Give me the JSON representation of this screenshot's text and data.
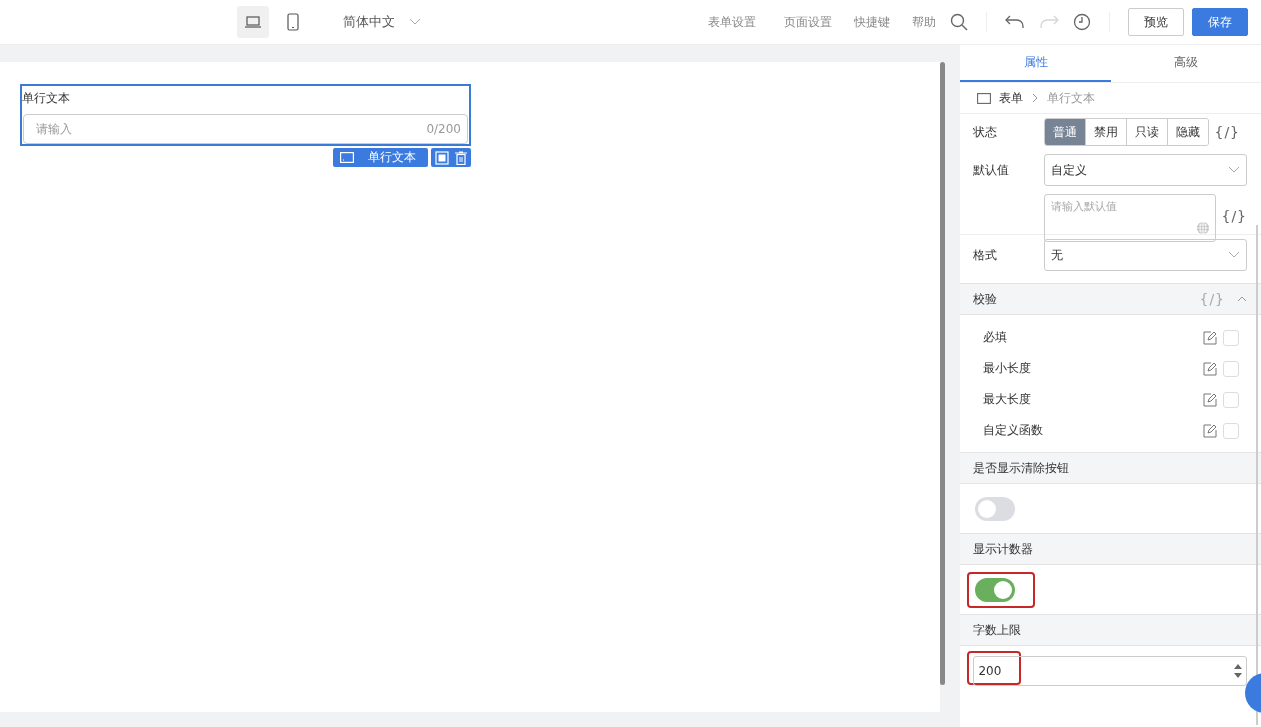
{
  "toolbar": {
    "devices": [
      {
        "kind": "desktop",
        "selected": true
      },
      {
        "kind": "mobile",
        "selected": false
      }
    ],
    "language": "简体中文",
    "links": [
      "表单设置",
      "页面设置",
      "快捷键",
      "帮助"
    ],
    "history": [
      {
        "kind": "undo",
        "disabled": false
      },
      {
        "kind": "redo",
        "disabled": true
      }
    ],
    "preview": "预览",
    "save": "保存"
  },
  "canvas": {
    "field": {
      "label": "单行文本",
      "placeholder": "请输入",
      "counter": "0/200",
      "selected": true,
      "tag": "单行文本"
    }
  },
  "panel": {
    "tabs": [
      {
        "label": "属性",
        "selected": true
      },
      {
        "label": "高级",
        "selected": false
      }
    ],
    "breadcrumb": [
      "表单",
      "单行文本"
    ],
    "status": {
      "label": "状态",
      "expr": "{/}",
      "options": [
        {
          "label": "普通",
          "selected": true
        },
        {
          "label": "禁用",
          "selected": false
        },
        {
          "label": "只读",
          "selected": false
        },
        {
          "label": "隐藏",
          "selected": false
        }
      ]
    },
    "default_value": {
      "label": "默认值",
      "value": "自定义",
      "placeholder": "请输入默认值",
      "expr": "{/}"
    },
    "format": {
      "label": "格式",
      "value": "无"
    },
    "validation": {
      "title": "校验",
      "expr": "{/}",
      "expanded": true,
      "rules": [
        {
          "label": "必填",
          "checked": false
        },
        {
          "label": "最小长度",
          "checked": false
        },
        {
          "label": "最大长度",
          "checked": false
        },
        {
          "label": "自定义函数",
          "checked": false
        }
      ]
    },
    "show_clear": {
      "title": "是否显示清除按钮",
      "on": false,
      "highlighted": false
    },
    "show_counter": {
      "title": "显示计数器",
      "on": true,
      "highlighted": true
    },
    "max_length": {
      "title": "字数上限",
      "value": "200",
      "highlighted": true
    }
  }
}
